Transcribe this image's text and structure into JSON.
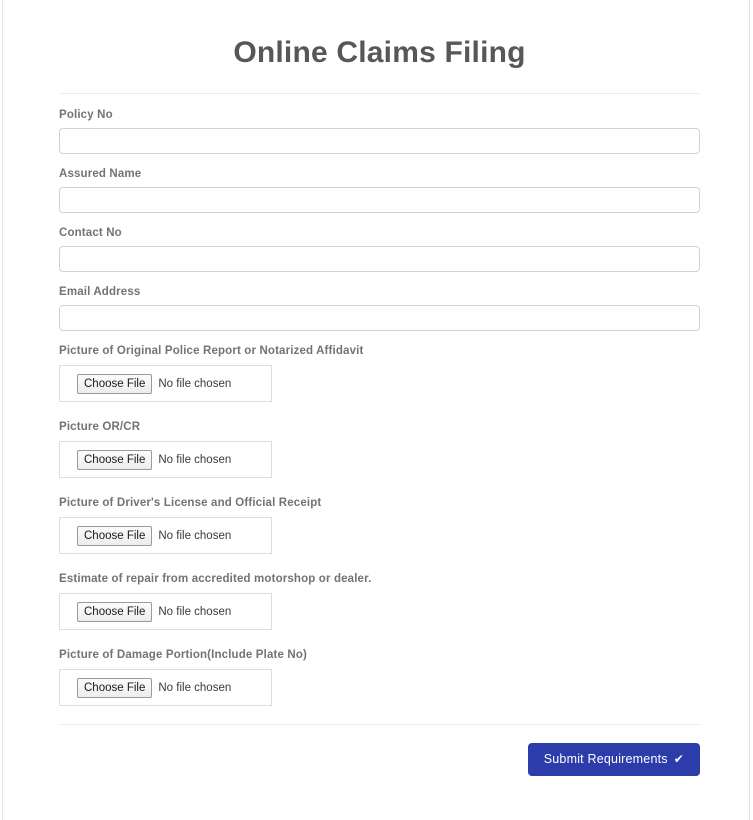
{
  "page": {
    "title": "Online Claims Filing"
  },
  "theme": {
    "title_color": "#575757",
    "label_color": "#737373",
    "divider_color": "#eceaea",
    "input_border_color": "#d2d2d2",
    "submit_button_color": "#2c3cab",
    "submit_button_text_color": "#ffffff"
  },
  "form": {
    "text_fields": [
      {
        "label": "Policy No",
        "value": "",
        "placeholder": ""
      },
      {
        "label": "Assured Name",
        "value": "",
        "placeholder": ""
      },
      {
        "label": "Contact No",
        "value": "",
        "placeholder": ""
      },
      {
        "label": "Email Address",
        "value": "",
        "placeholder": ""
      }
    ],
    "file_fields": [
      {
        "label": "Picture of Original Police Report or Notarized Affidavit",
        "button_label": "Choose File",
        "status": "No file chosen"
      },
      {
        "label": "Picture OR/CR",
        "button_label": "Choose File",
        "status": "No file chosen"
      },
      {
        "label": "Picture of Driver's License and Official Receipt",
        "button_label": "Choose File",
        "status": "No file chosen"
      },
      {
        "label": "Estimate of repair from accredited motorshop or dealer.",
        "button_label": "Choose File",
        "status": "No file chosen"
      },
      {
        "label": "Picture of Damage Portion(Include Plate No)",
        "button_label": "Choose File",
        "status": "No file chosen"
      }
    ],
    "submit": {
      "label": "Submit Requirements",
      "icon": "check-icon",
      "icon_glyph": "✔"
    }
  }
}
